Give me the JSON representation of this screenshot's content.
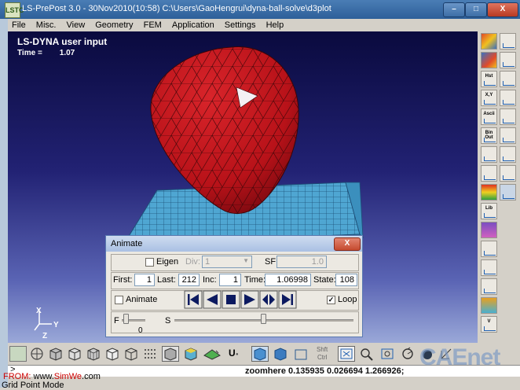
{
  "window": {
    "app_icon": "LSTC",
    "title": "LS-PrePost 3.0 - 30Nov2010(10:58) C:\\Users\\GaoHengrui\\dyna-ball-solve\\d3plot",
    "minimize": "–",
    "maximize": "□",
    "close": "X"
  },
  "menu": [
    "File",
    "Misc.",
    "View",
    "Geometry",
    "FEM",
    "Application",
    "Settings",
    "Help"
  ],
  "viewport": {
    "title": "LS-DYNA user input",
    "time_label": "Time =",
    "time_value": "1.07",
    "axis_x": "X",
    "axis_y": "Y",
    "axis_z": "Z",
    "ball_color": "#c0161e",
    "plate_color": "#4aa0cc"
  },
  "right_toolbar": {
    "labels": [
      "Hst",
      "X,Y",
      "Ascii",
      "Bin Out",
      "Lib",
      "V"
    ]
  },
  "animate": {
    "title": "Animate",
    "close": "X",
    "eigen_label": "Eigen",
    "eigen_checked": false,
    "div_label": "Div:",
    "div_value": "1",
    "sf_label": "SF:",
    "sf_value": "1.0",
    "first_label": "First:",
    "first_value": "1",
    "last_label": "Last:",
    "last_value": "212",
    "inc_label": "Inc:",
    "inc_value": "1",
    "time_label": "Time:",
    "time_value": "1.06998",
    "state_label": "State:",
    "state_value": "108",
    "animate_label": "Animate",
    "animate_checked": false,
    "loop_label": "Loop",
    "loop_checked": true,
    "loop_check_mark": "✓",
    "f_label": "F",
    "s_label": "S",
    "f_value": "0",
    "speed_fraction": 0.5
  },
  "bottom_toolbar": {
    "u_label": "U",
    "shift_label": "Shft",
    "ctrl_label": "Ctrl"
  },
  "command": {
    "prompt": ">",
    "message": "zoomhere 0.135935 0.026694 1.266926;"
  },
  "status": {
    "from_prefix": "FROM: ",
    "from_www": "www.",
    "from_site": "SimWe",
    "from_suffix": ".com",
    "mode": "Grid Point Mode",
    "watermark": "CAEnet"
  }
}
